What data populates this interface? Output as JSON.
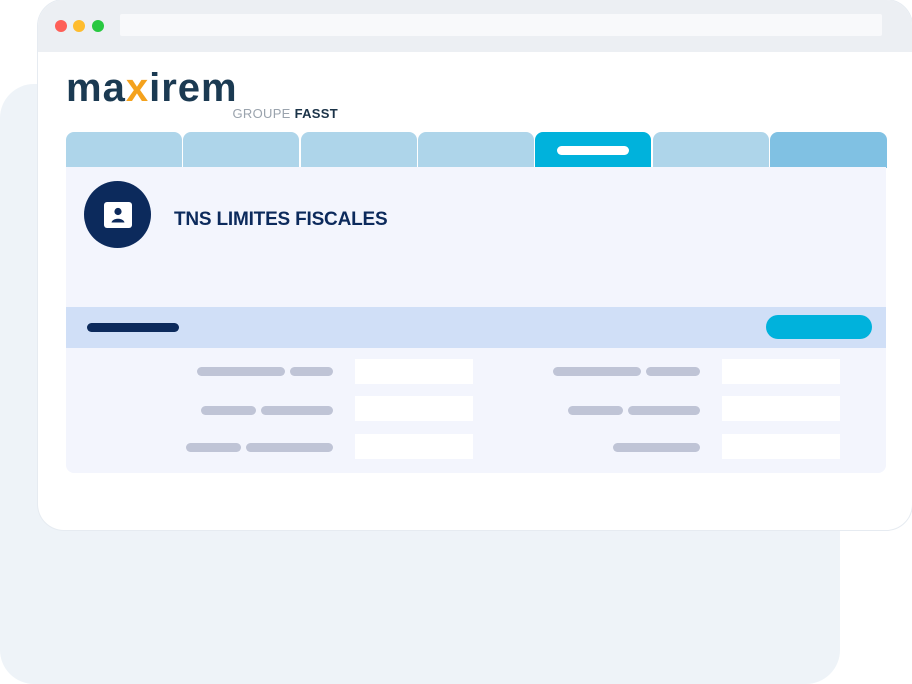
{
  "brand": {
    "logo_text": "maxirem",
    "group_prefix": "GROUPE",
    "group_name": "FASST",
    "colors": {
      "navy": "#1b3a52",
      "accent": "#f4a21d",
      "cyan": "#00b2dc"
    }
  },
  "window": {
    "controls": [
      {
        "name": "close",
        "color": "#fe5f57"
      },
      {
        "name": "minimize",
        "color": "#febc2e"
      },
      {
        "name": "maximize",
        "color": "#28c840"
      }
    ],
    "address_bar": {
      "value": ""
    }
  },
  "tabs": [
    {
      "label": "",
      "state": "default"
    },
    {
      "label": "",
      "state": "default"
    },
    {
      "label": "",
      "state": "default"
    },
    {
      "label": "",
      "state": "default"
    },
    {
      "label": "",
      "state": "active"
    },
    {
      "label": "",
      "state": "default"
    },
    {
      "label": "",
      "state": "last"
    }
  ],
  "panel": {
    "icon": "id-card-icon",
    "title": "TNS LIMITES FISCALES",
    "section": {
      "label": "",
      "button_label": ""
    },
    "fields": [
      {
        "value": ""
      },
      {
        "value": ""
      },
      {
        "value": ""
      },
      {
        "value": ""
      },
      {
        "value": ""
      },
      {
        "value": ""
      }
    ]
  }
}
